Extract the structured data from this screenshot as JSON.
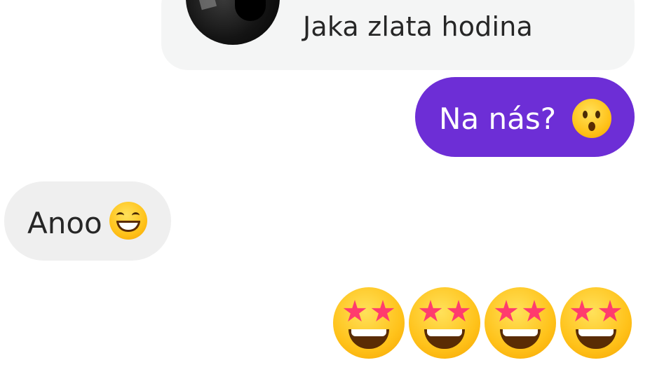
{
  "reply_preview": {
    "text": "Jaka zlata hodina"
  },
  "messages": [
    {
      "direction": "outgoing",
      "text": "Na nás?",
      "emoji": "astonished-face"
    },
    {
      "direction": "incoming",
      "text": "Anoo",
      "emoji": "grinning-face-with-smiling-eyes"
    },
    {
      "direction": "outgoing",
      "text": "",
      "emoji": "star-struck x4"
    }
  ],
  "colors": {
    "outgoing_bubble": "#6d2ed6",
    "incoming_bubble": "#efefef",
    "reply_preview_bg": "#f4f5f5"
  }
}
